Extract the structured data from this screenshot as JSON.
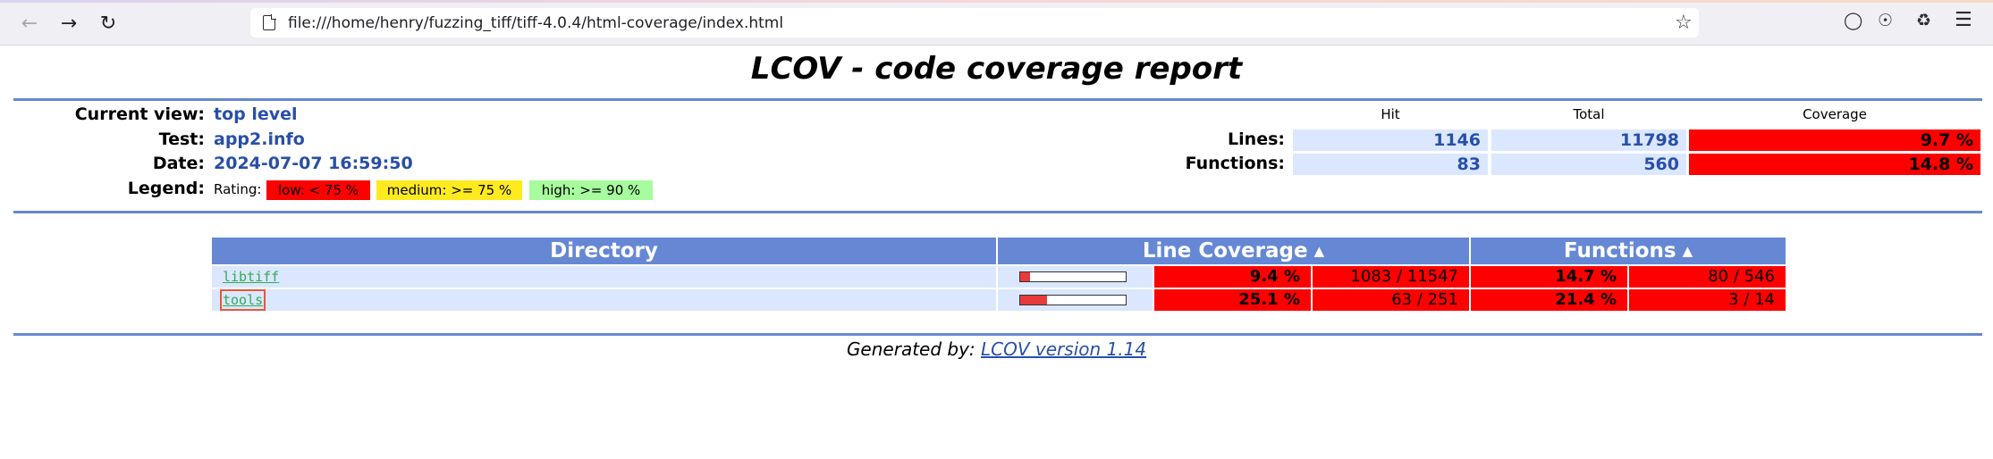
{
  "browser": {
    "url": "file:///home/henry/fuzzing_tiff/tiff-4.0.4/html-coverage/index.html",
    "icons": [
      "back-arrow-icon",
      "forward-arrow-icon",
      "reload-icon",
      "page-icon",
      "star-icon",
      "pocket-icon",
      "account-icon",
      "extensions-icon",
      "menu-icon"
    ]
  },
  "page": {
    "title": "LCOV - code coverage report"
  },
  "info": {
    "current_view_label": "Current view:",
    "current_view_value": "top level",
    "test_label": "Test:",
    "test_value": "app2.info",
    "date_label": "Date:",
    "date_value": "2024-07-07 16:59:50",
    "legend_label": "Legend:",
    "rating_text": "Rating:",
    "legend_low": "low: < 75 %",
    "legend_medium": "medium: >= 75 %",
    "legend_high": "high: >= 90 %"
  },
  "summary": {
    "hit_header": "Hit",
    "total_header": "Total",
    "coverage_header": "Coverage",
    "lines_label": "Lines:",
    "lines_hit": "1146",
    "lines_total": "11798",
    "lines_coverage": "9.7 %",
    "functions_label": "Functions:",
    "functions_hit": "83",
    "functions_total": "560",
    "functions_coverage": "14.8 %"
  },
  "table": {
    "headers": {
      "directory": "Directory",
      "line_coverage": "Line Coverage",
      "functions": "Functions"
    },
    "rows": [
      {
        "name": "libtiff",
        "line_fraction": 0.094,
        "line_pct": "9.4 %",
        "line_count": "1083 / 11547",
        "func_pct": "14.7 %",
        "func_count": "80 / 546"
      },
      {
        "name": "tools",
        "line_fraction": 0.251,
        "line_pct": "25.1 %",
        "line_count": "63 / 251",
        "func_pct": "21.4 %",
        "func_count": "3 / 14"
      }
    ]
  },
  "footer": {
    "prefix": "Generated by: ",
    "link": "LCOV version 1.14"
  },
  "colors": {
    "ruler": "#6688d4",
    "low": "#ff0000",
    "medium": "#ffea20",
    "high": "#a7fc9d",
    "value_text": "#284fa8"
  }
}
